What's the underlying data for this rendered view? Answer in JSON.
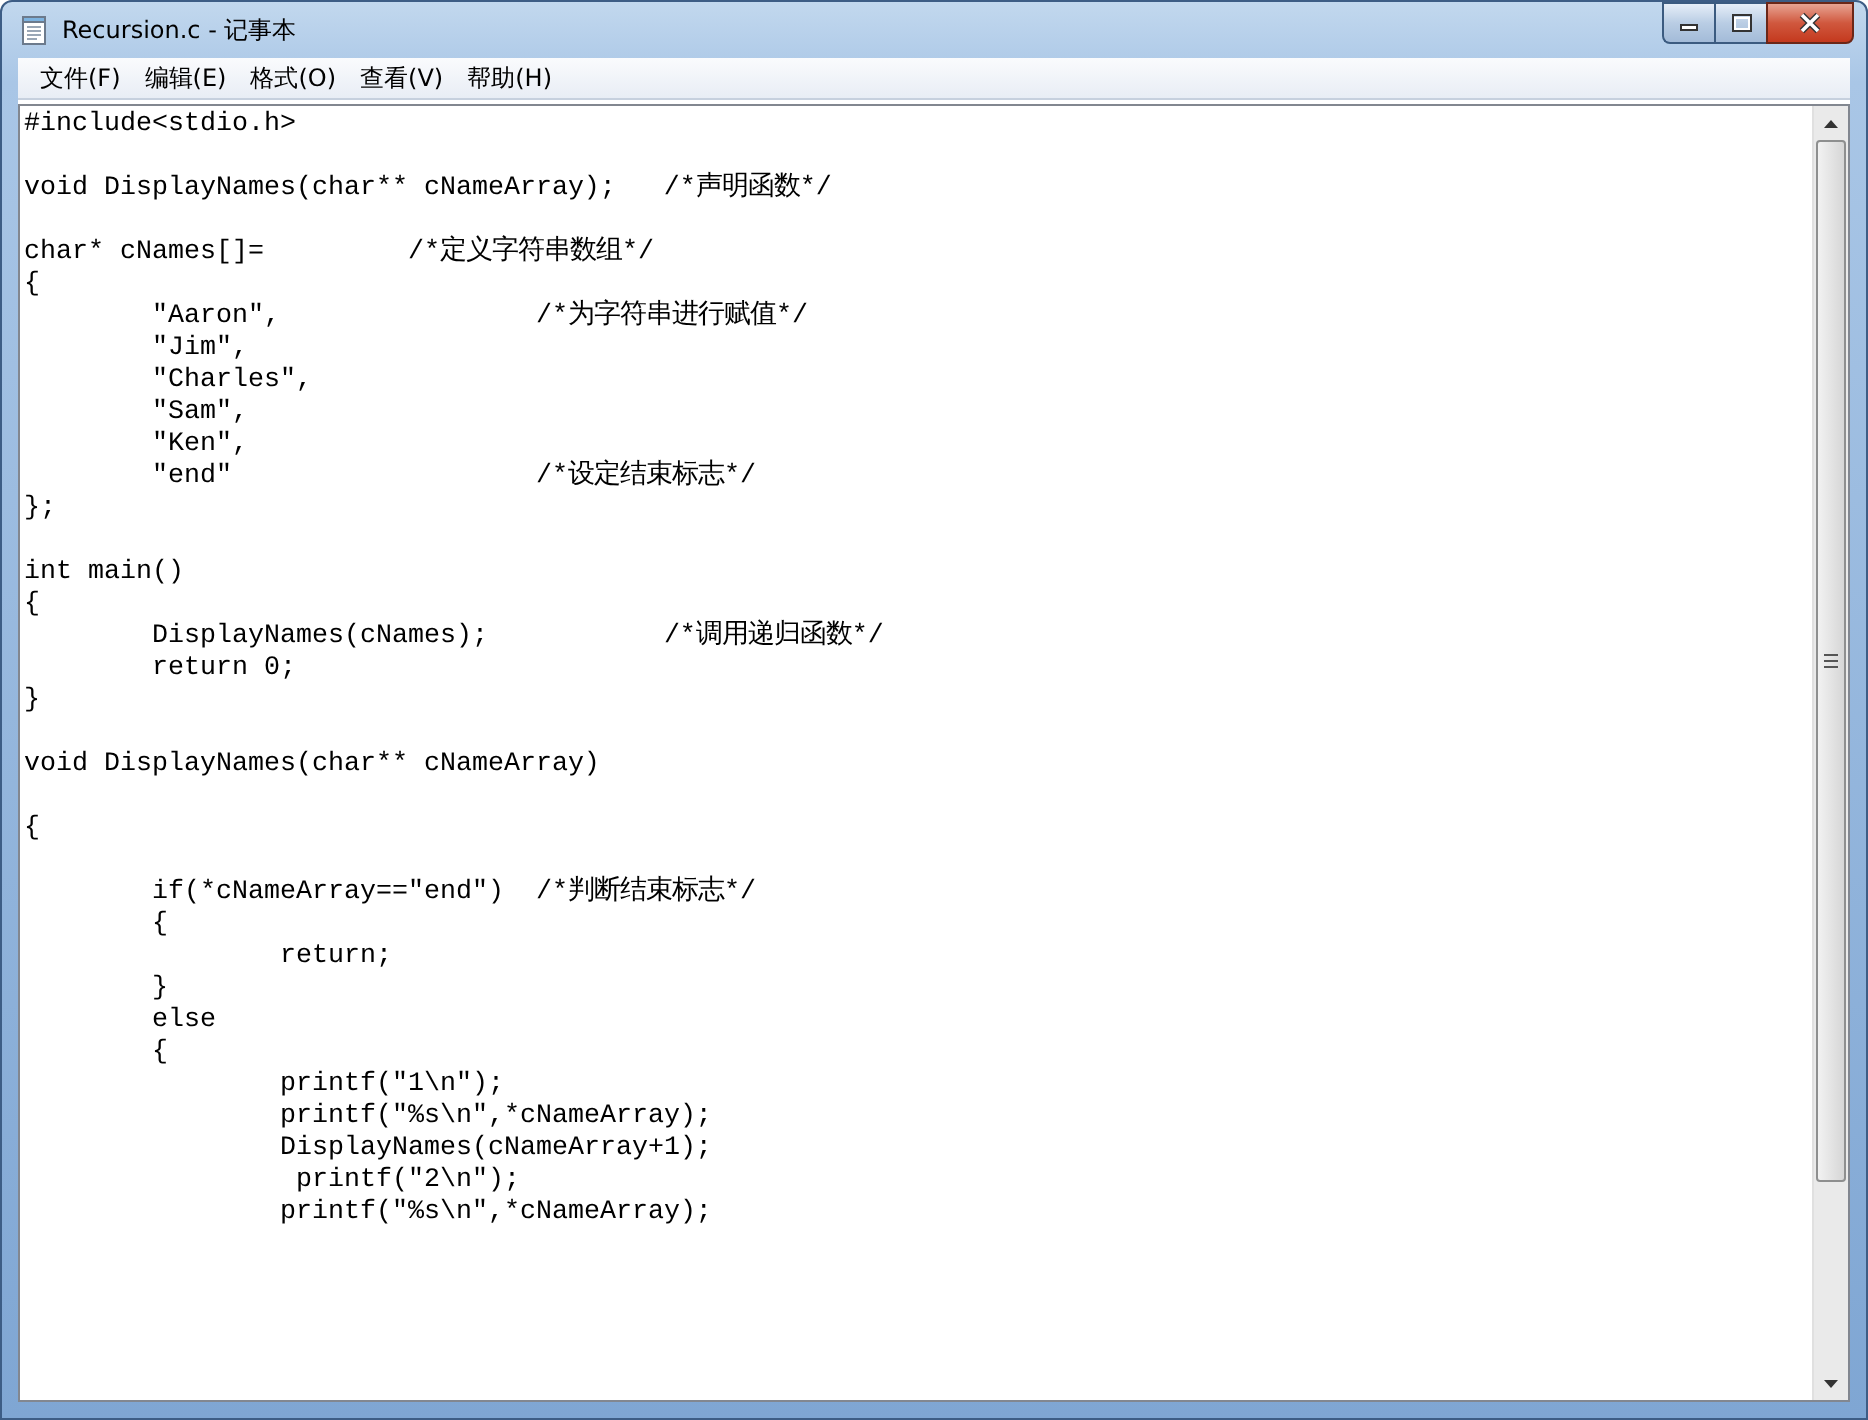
{
  "window": {
    "title": "Recursion.c - 记事本"
  },
  "menu": [
    "文件(F)",
    "编辑(E)",
    "格式(O)",
    "查看(V)",
    "帮助(H)"
  ],
  "editor": {
    "text": "#include<stdio.h>\n\nvoid DisplayNames(char** cNameArray);   /*声明函数*/\n\nchar* cNames[]=\t\t/*定义字符串数组*/\n{\n\t\"Aaron\",\t\t/*为字符串进行赋值*/\n\t\"Jim\",\n\t\"Charles\",\n\t\"Sam\",\n\t\"Ken\",\n\t\"end\"\t\t\t/*设定结束标志*/\n};\n\nint main()\n{\n\tDisplayNames(cNames);\t\t/*调用递归函数*/\n\treturn 0;\n}\n\nvoid DisplayNames(char** cNameArray)\n\n{\n\n\tif(*cNameArray==\"end\")  /*判断结束标志*/\n\t{\n\t\treturn;\n\t}\n\telse\n\t{\n\t\tprintf(\"1\\n\");\n\t\tprintf(\"%s\\n\",*cNameArray);\n\t\tDisplayNames(cNameArray+1);\n\t\t printf(\"2\\n\");\n\t\tprintf(\"%s\\n\",*cNameArray);"
  }
}
